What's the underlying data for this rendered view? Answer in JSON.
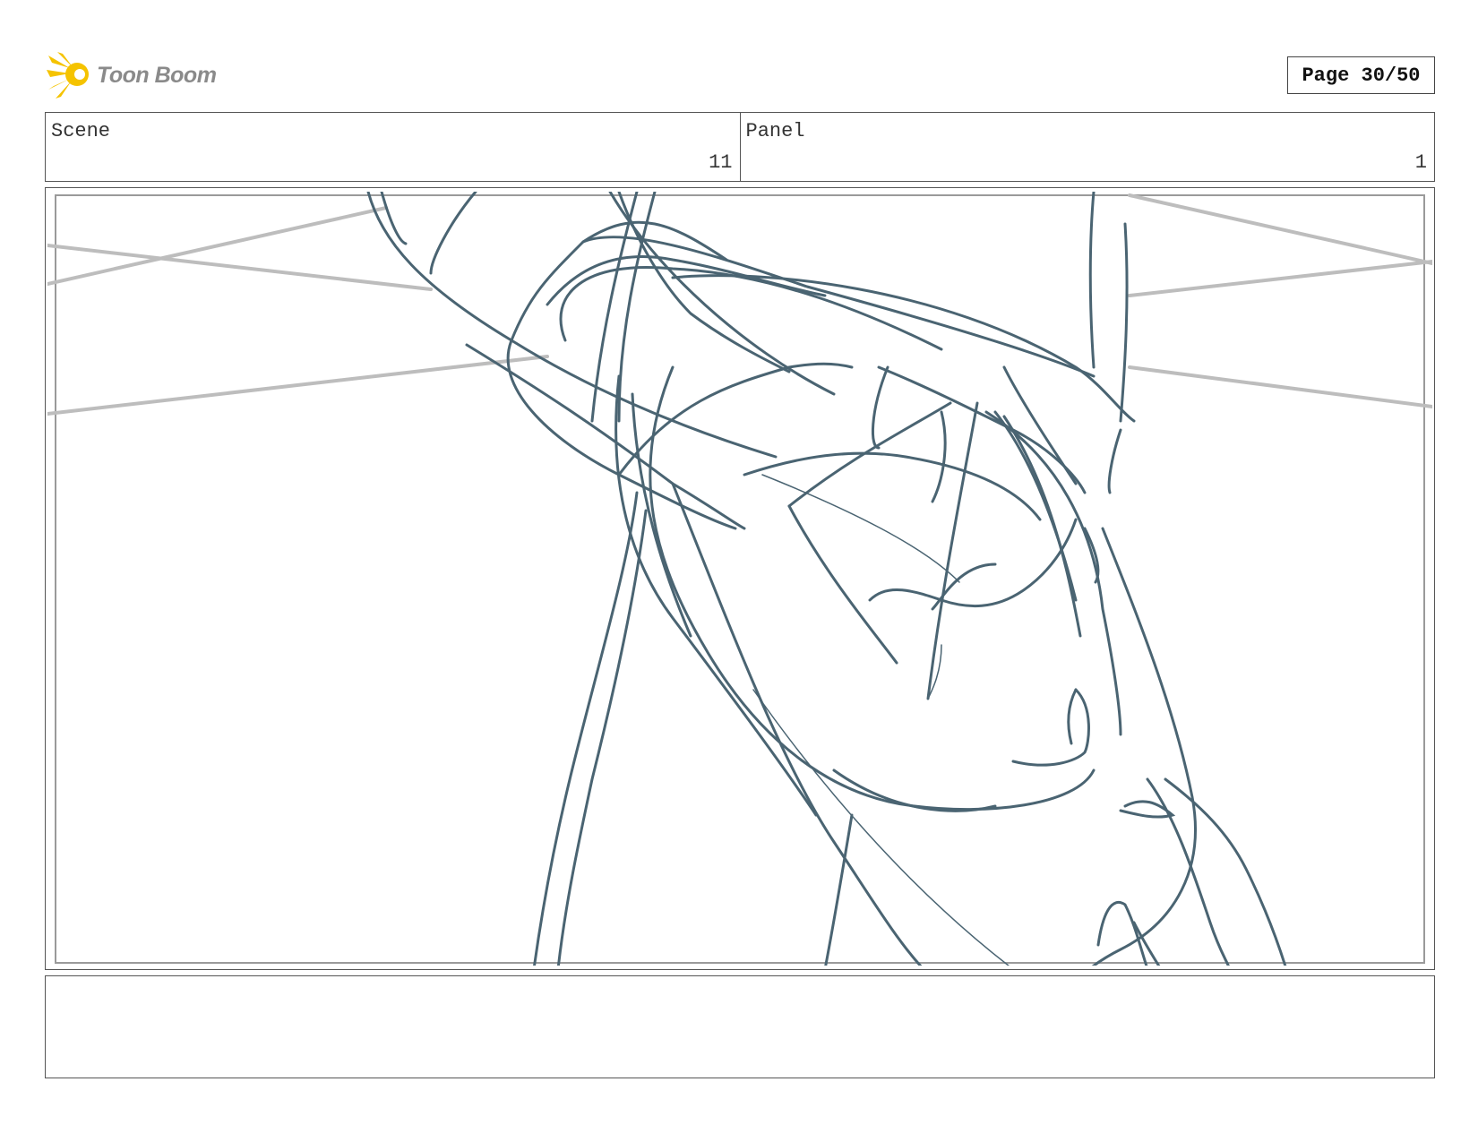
{
  "header": {
    "logo_text": "Toon Boom",
    "page_label": "Page 30/50"
  },
  "fields": {
    "scene_label": "Scene",
    "scene_value": "11",
    "panel_label": "Panel",
    "panel_value": "1"
  },
  "colors": {
    "sketch_stroke": "#4a6472",
    "guide_stroke": "#bdbdbd",
    "logo_accent": "#f5c300"
  },
  "notes": ""
}
